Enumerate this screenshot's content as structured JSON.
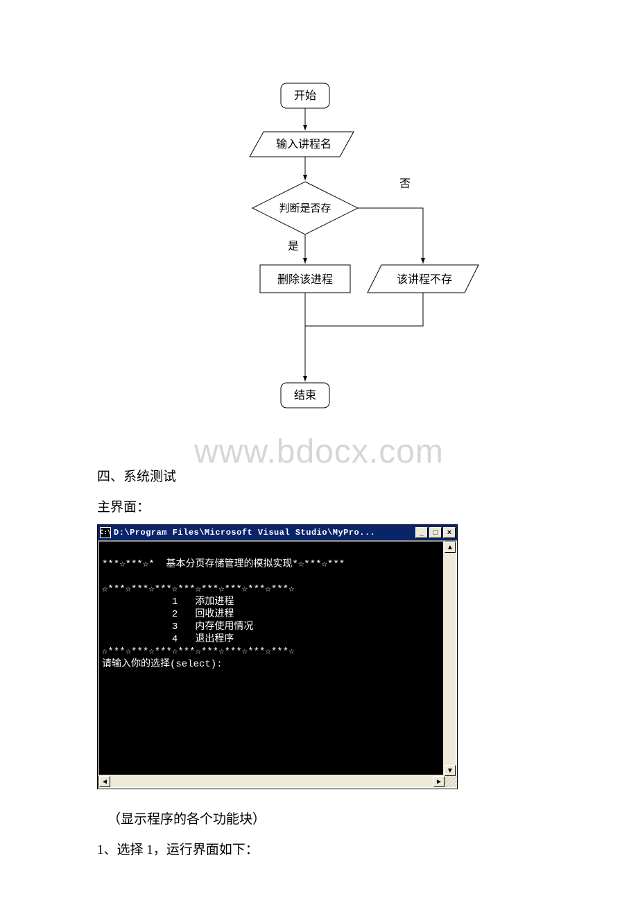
{
  "watermark": "www.bdocx.com",
  "flowchart": {
    "start": "开始",
    "input": "输入讲程名",
    "decision": "判断是否存",
    "yes": "是",
    "no": "否",
    "delete": "删除该进程",
    "notexist": "该讲程不存",
    "end": "结束"
  },
  "section_heading": "四、系统测试",
  "main_label": "主界面：",
  "console": {
    "title": "D:\\Program Files\\Microsoft Visual Studio\\MyPro...",
    "icon_text": "C:\\",
    "minimize_glyph": "_",
    "maximize_glyph": "□",
    "close_glyph": "×",
    "up_glyph": "▲",
    "down_glyph": "▼",
    "left_glyph": "◄",
    "right_glyph": "►",
    "lines": [
      "",
      "***☆***☆*  基本分页存储管理的模拟实现*☆***☆***",
      "",
      "☆***☆***☆***☆***☆***☆***☆***☆***☆",
      "            1   添加进程",
      "            2   回收进程",
      "            3   内存使用情况",
      "            4   退出程序",
      "☆***☆***☆***☆***☆***☆***☆***☆***☆",
      "请输入你的选择(select):"
    ]
  },
  "note1": "（显示程序的各个功能块）",
  "note2": "1、选择 1，运行界面如下："
}
